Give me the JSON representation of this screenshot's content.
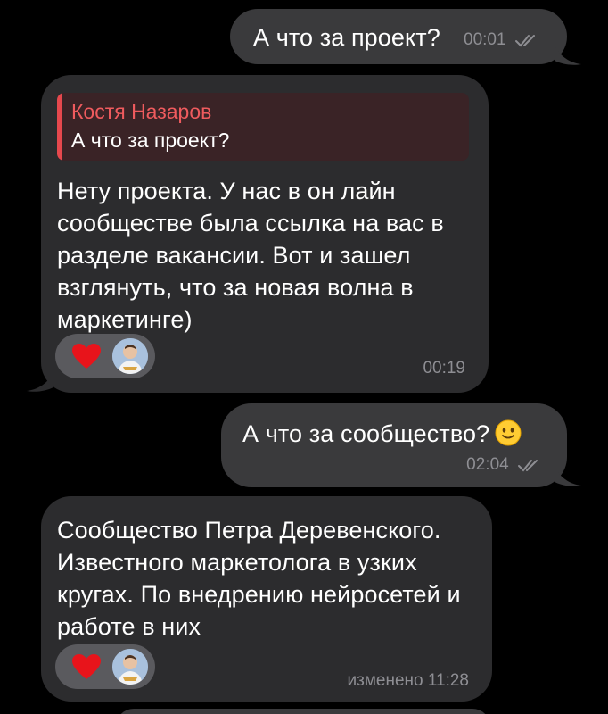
{
  "messages": [
    {
      "id": "m1",
      "direction": "outgoing",
      "text": "А что за проект?",
      "time": "00:01",
      "status": "read"
    },
    {
      "id": "m2",
      "direction": "incoming",
      "reply": {
        "author": "Костя Назаров",
        "text": "А что за проект?"
      },
      "text": "Нету проекта. У нас в он лайн сообществе была ссылка на вас в разделе вакансии. Вот и зашел взглянуть, что за новая волна в маркетинге)",
      "reactions": [
        "heart-icon",
        "avatar"
      ],
      "time": "00:19"
    },
    {
      "id": "m3",
      "direction": "outgoing",
      "text": "А что за сообщество?",
      "emoji": "slightly-smiling-face",
      "time": "02:04",
      "status": "read"
    },
    {
      "id": "m4",
      "direction": "incoming",
      "text": "Сообщество Петра Деревенского. Известного маркетолога в узких кругах. По внедрению нейросетей и работе в них",
      "reactions": [
        "heart-icon",
        "avatar"
      ],
      "time": "изменено 11:28"
    }
  ],
  "colors": {
    "background": "#000000",
    "outgoing_bubble": "#3a3a3c",
    "incoming_bubble": "#2c2c2e",
    "reply_accent": "#e5484d",
    "time_text": "#8e8e93"
  }
}
